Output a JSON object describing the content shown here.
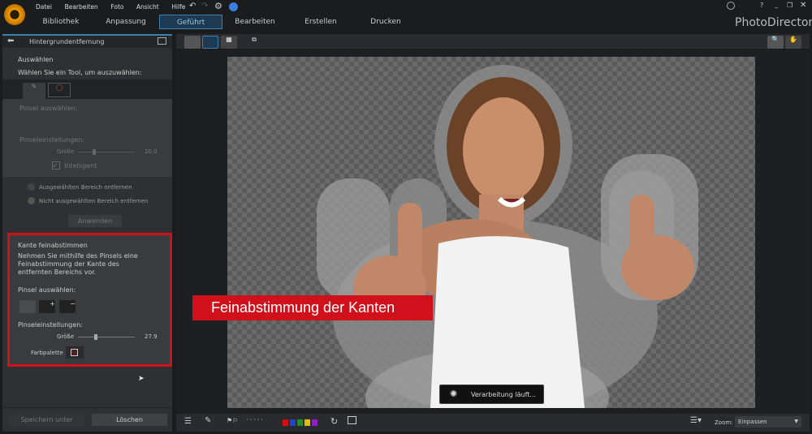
{
  "menu": [
    "Datei",
    "Bearbeiten",
    "Foto",
    "Ansicht",
    "Hilfe"
  ],
  "tabs": [
    {
      "label": "Bibliothek"
    },
    {
      "label": "Anpassung"
    },
    {
      "label": "Geführt",
      "active": true
    },
    {
      "label": "Bearbeiten"
    },
    {
      "label": "Erstellen"
    },
    {
      "label": "Drucken"
    }
  ],
  "app_title": "PhotoDirector",
  "window": {
    "help": "?"
  },
  "panel": {
    "title": "Hintergrundentfernung",
    "select_heading": "Auswählen",
    "select_hint": "Wählen Sie ein Tool, um auszuwählen:",
    "brush_select": "Pinsel auswählen:",
    "brush_settings": "Pinseleinstellungen:",
    "size_label": "Größe",
    "size_value": "20.0",
    "size_fraction": 0.25,
    "intelligent": "Intelligent",
    "radio_remove_selected": "Ausgewählten Bereich entfernen",
    "radio_remove_unselected": "Nicht ausgewählten Bereich entfernen",
    "apply": "Anwenden",
    "refine": {
      "heading": "Kante feinabstimmen",
      "desc": "Nehmen Sie mithilfe des Pinsels eine Feinabstimmung der Kante des entfernten Bereichs vor.",
      "brush_select": "Pinsel auswählen:",
      "brush_settings": "Pinseleinstellungen:",
      "size_label": "Größe",
      "size_value": "27.9",
      "size_fraction": 0.28,
      "palette": "Farbpalette"
    },
    "save_as": "Speichern unter",
    "delete": "Löschen"
  },
  "overlay_label": "Feinabstimmung der Kanten",
  "processing": "Verarbeitung läuft...",
  "bottom": {
    "zoom_label": "Zoom:",
    "zoom_value": "Einpassen",
    "color_labels": [
      "#d01010",
      "#2040d0",
      "#2a8a2a",
      "#e0c000",
      "#8a20c0"
    ]
  },
  "colors": {
    "accent": "#3c7fb3",
    "highlight": "#d0101a"
  }
}
